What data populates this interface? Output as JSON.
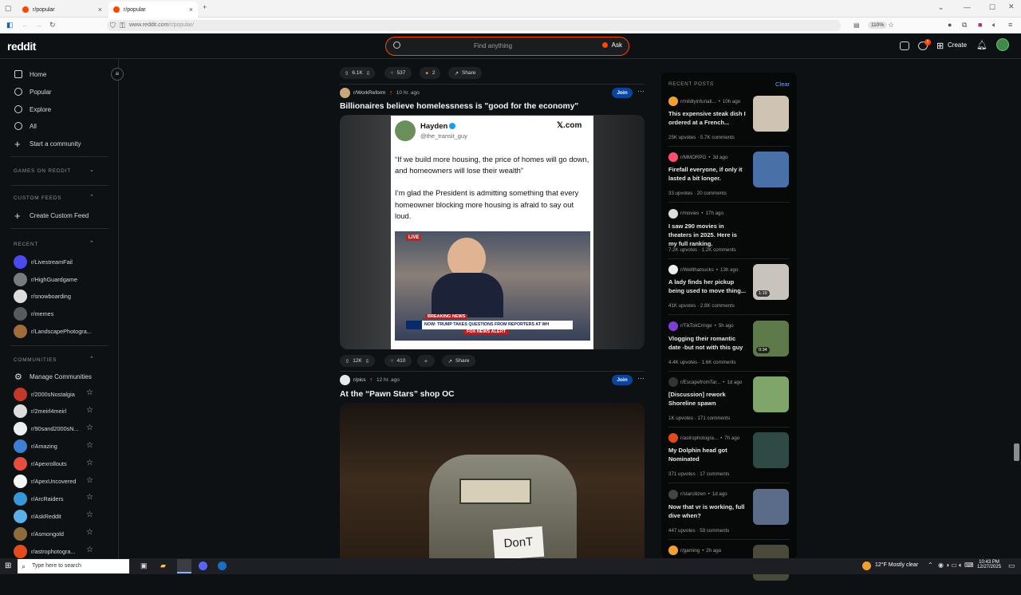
{
  "browser": {
    "tabs": [
      {
        "title": "r/popular"
      },
      {
        "title": "r/popular"
      }
    ],
    "url_host": "www.reddit.com",
    "url_path": "/r/popular/",
    "zoom": "110%"
  },
  "header": {
    "logo": "reddit",
    "search_placeholder": "Find anything",
    "ask_label": "Ask",
    "create_label": "Create",
    "chat_badge": "1"
  },
  "sidebar": {
    "nav": [
      {
        "label": "Home",
        "icon": "home-icon"
      },
      {
        "label": "Popular",
        "icon": "popular-icon"
      },
      {
        "label": "Explore",
        "icon": "explore-icon"
      },
      {
        "label": "All",
        "icon": "all-icon"
      },
      {
        "label": "Start a community",
        "icon": "plus-icon"
      }
    ],
    "games_label": "GAMES ON REDDIT",
    "custom_feeds_label": "CUSTOM FEEDS",
    "create_custom_feed": "Create Custom Feed",
    "recent_label": "RECENT",
    "recent": [
      {
        "name": "r/LivestreamFail",
        "color": "#4a4af0"
      },
      {
        "name": "r/HighGuardgame",
        "color": "#7a7a7a"
      },
      {
        "name": "r/snowboarding",
        "color": "#dcdcdc"
      },
      {
        "name": "r/memes",
        "color": "#5a5a5a"
      },
      {
        "name": "r/LandscapePhotogra...",
        "color": "#a36a3a"
      }
    ],
    "communities_label": "COMMUNITIES",
    "manage_communities": "Manage Communities",
    "communities": [
      {
        "name": "r/2000sNostalgia",
        "color": "#c0392b"
      },
      {
        "name": "r/2meirl4meirl",
        "color": "#dddddd"
      },
      {
        "name": "r/90sand2000sN...",
        "color": "#eeeeee"
      },
      {
        "name": "r/Amazing",
        "color": "#3d7fd6"
      },
      {
        "name": "r/Apexrollouts",
        "color": "#e74c3c"
      },
      {
        "name": "r/ApexUncovered",
        "color": "#f5f5f5"
      },
      {
        "name": "r/ArcRaiders",
        "color": "#3498db"
      },
      {
        "name": "r/AskReddit",
        "color": "#5ab0e8"
      },
      {
        "name": "r/Asmongold",
        "color": "#8e6b3c"
      },
      {
        "name": "r/astrophotogra...",
        "color": "#e34b1b"
      }
    ]
  },
  "feed": {
    "prev_actions": {
      "votes": "6.1K",
      "comments": "537",
      "awards": "2",
      "share": "Share"
    },
    "posts": [
      {
        "subreddit": "r/WorkReform",
        "time": "10 hr. ago",
        "join": "Join",
        "title": "Billionaires believe homelessness is \"good for the economy\"",
        "tweet": {
          "name": "Hayden",
          "handle": "@the_transit_guy",
          "brand": "𝕏.com",
          "quote": "“If we build more housing, the price of homes will go down, and homeowners will lose their wealth”",
          "body": "I’m glad the President is admitting something that every homeowner blocking more housing is afraid to say out loud.",
          "live": "LIVE",
          "breaking": "BREAKING NEWS",
          "chyron": "NOW: TRUMP TAKES QUESTIONS FROM REPORTERS AT WH",
          "alert": "FOX NEWS ALERT"
        },
        "votes": "12K",
        "comments": "410",
        "share": "Share"
      },
      {
        "subreddit": "r/pics",
        "time": "12 hr. ago",
        "join": "Join",
        "title": "At the “Pawn Stars” shop OC",
        "sign_text": "DonT"
      }
    ]
  },
  "recent_posts": {
    "label": "RECENT POSTS",
    "clear": "Clear",
    "items": [
      {
        "sub": "r/mildlyinfuriati...",
        "age": "10h ago",
        "title": "This expensive steak dish I ordered at a French...",
        "stats": "25K upvotes · 5.7K comments",
        "thumb": "#cfc4b3",
        "sub_color": "#f0a030"
      },
      {
        "sub": "r/MMORPG",
        "age": "3d ago",
        "title": "Firefall everyone, if only it lasted a bit longer.",
        "stats": "33 upvotes · 20 comments",
        "thumb": "#4a70a8",
        "sub_color": "#ff4f70"
      },
      {
        "sub": "r/movies",
        "age": "17h ago",
        "title": "I saw 290 movies in theaters in 2025. Here is my full ranking.",
        "stats": "7.2K upvotes · 1.2K comments",
        "thumb": "",
        "sub_color": "#dddddd"
      },
      {
        "sub": "r/Wellthatsucks",
        "age": "13h ago",
        "title": "A lady finds her pickup being used to move thing...",
        "stats": "41K upvotes · 2.8K comments",
        "thumb": "#c8c4bd",
        "sub_color": "#eeeeee",
        "badge": "1:19"
      },
      {
        "sub": "r/TikTokCringe",
        "age": "5h ago",
        "title": "Vlogging their romantic date -but not with this guy",
        "stats": "4.4K upvotes · 1.6K comments",
        "thumb": "#5f7a4a",
        "sub_color": "#7d3fd0",
        "badge": "0:34"
      },
      {
        "sub": "r/EscapefromTar...",
        "age": "1d ago",
        "title": "[Discussion] rework Shoreline spawn",
        "stats": "1K upvotes · 171 comments",
        "thumb": "#7fa56a",
        "sub_color": "#333333"
      },
      {
        "sub": "r/astrophotogra...",
        "age": "7h ago",
        "title": "My Dolphin head got Nominated",
        "stats": "371 upvotes · 17 comments",
        "thumb": "#2f4a45",
        "sub_color": "#e34b1b"
      },
      {
        "sub": "r/starcitizen",
        "age": "1d ago",
        "title": "Now that vr is working, full dive when?",
        "stats": "447 upvotes · 59 comments",
        "thumb": "#5a6c88",
        "sub_color": "#444444"
      },
      {
        "sub": "r/gaming",
        "age": "2h ago",
        "title": "",
        "stats": "",
        "thumb": "#4a4a3a",
        "sub_color": "#f5a030"
      }
    ]
  },
  "taskbar": {
    "search_placeholder": "Type here to search",
    "weather": "12°F  Mostly clear",
    "time": "10:43 PM",
    "date": "12/27/2025"
  },
  "colors": {
    "accent": "#ff4500",
    "join": "#0a449b",
    "bg": "#0e1113"
  }
}
